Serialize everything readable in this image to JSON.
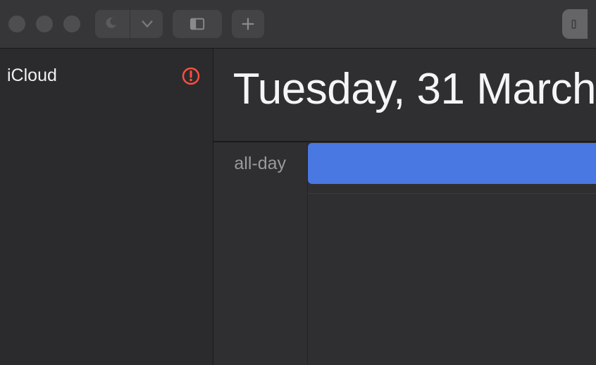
{
  "toolbar": {
    "appearance_icon": "moon-icon",
    "chevron_icon": "chevron-down-icon",
    "panel_icon": "sidebar-panel-icon",
    "plus_icon": "plus-icon"
  },
  "sidebar": {
    "account_label": "iCloud",
    "alert_icon": "alert-icon"
  },
  "calendar": {
    "date_title": "Tuesday, 31 March",
    "allday_label": "all-day"
  },
  "colors": {
    "event_blue": "#4a78e3",
    "alert_red": "#ff4e40"
  }
}
